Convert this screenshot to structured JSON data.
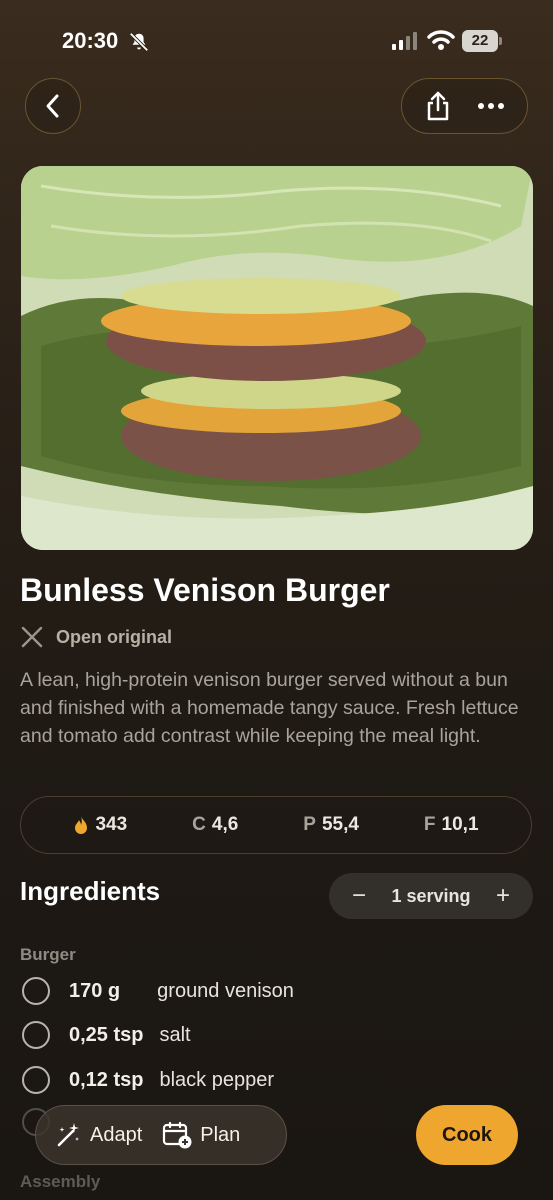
{
  "status_bar": {
    "time": "20:30",
    "battery": "22"
  },
  "recipe": {
    "title": "Bunless Venison Burger",
    "source_label": "Open original",
    "description": "A lean, high-protein venison burger served without a bun and finished with a homemade tangy sauce. Fresh lettuce and tomato add contrast while keeping the meal light."
  },
  "macros": {
    "calories": "343",
    "carbs_label": "C",
    "carbs": "4,6",
    "protein_label": "P",
    "protein": "55,4",
    "fat_label": "F",
    "fat": "10,1"
  },
  "ingredients_section": {
    "title": "Ingredients",
    "serving_label": "1 serving",
    "groups": [
      {
        "label": "Burger",
        "items": [
          {
            "qty": "170 g",
            "name": "ground venison"
          },
          {
            "qty": "0,25 tsp",
            "name": "salt"
          },
          {
            "qty": "0,12 tsp",
            "name": "black pepper"
          }
        ]
      },
      {
        "label": "Assembly"
      }
    ]
  },
  "bottom_bar": {
    "adapt_label": "Adapt",
    "plan_label": "Plan",
    "cook_label": "Cook"
  },
  "colors": {
    "accent": "#eea62f",
    "background": "#2a2118"
  }
}
